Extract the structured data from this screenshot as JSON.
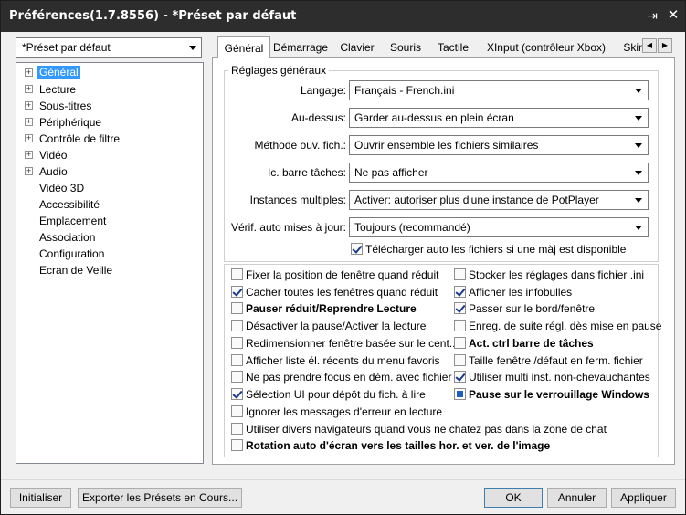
{
  "window": {
    "title": "Préférences(1.7.8556) - *Préset par défaut",
    "pin_glyph": "⇥",
    "close_glyph": "✕"
  },
  "preset_select": {
    "value": "*Préset par défaut"
  },
  "tree": {
    "items": [
      {
        "label": "Général",
        "expandable": true,
        "selected": true
      },
      {
        "label": "Lecture",
        "expandable": true
      },
      {
        "label": "Sous-titres",
        "expandable": true
      },
      {
        "label": "Périphérique",
        "expandable": true
      },
      {
        "label": "Contrôle de filtre",
        "expandable": true
      },
      {
        "label": "Vidéo",
        "expandable": true
      },
      {
        "label": "Audio",
        "expandable": true
      },
      {
        "label": "Vidéo 3D",
        "expandable": false
      },
      {
        "label": "Accessibilité",
        "expandable": false
      },
      {
        "label": "Emplacement",
        "expandable": false
      },
      {
        "label": "Association",
        "expandable": false
      },
      {
        "label": "Configuration",
        "expandable": false
      },
      {
        "label": "Ecran de Veille",
        "expandable": false
      }
    ],
    "expand_glyph": "+"
  },
  "tabs": [
    {
      "label": "Général",
      "active": true
    },
    {
      "label": "Démarrage"
    },
    {
      "label": "Clavier"
    },
    {
      "label": "Souris"
    },
    {
      "label": "Tactile"
    },
    {
      "label": "XInput (contrôleur Xbox)"
    },
    {
      "label": "Skin"
    }
  ],
  "tab_scroll": {
    "left": "◀",
    "right": "▶"
  },
  "general_group": {
    "title": "Réglages généraux",
    "rows": [
      {
        "label": "Langage:",
        "value": "Français - French.ini"
      },
      {
        "label": "Au-dessus:",
        "value": "Garder au-dessus en plein écran"
      },
      {
        "label": "Méthode ouv. fich.:",
        "value": "Ouvrir ensemble les fichiers similaires"
      },
      {
        "label": "Ic. barre tâches:",
        "value": "Ne pas afficher"
      },
      {
        "label": "Instances multiples:",
        "value": "Activer: autoriser plus d'une instance de PotPlayer"
      },
      {
        "label": "Vérif. auto mises à jour:",
        "value": "Toujours (recommandé)"
      }
    ],
    "auto_download": {
      "label": "Télécharger auto les fichiers si une màj est disponible",
      "checked": true
    }
  },
  "options": {
    "left": [
      {
        "label": "Fixer la position de fenêtre quand réduit",
        "checked": false
      },
      {
        "label": "Cacher toutes les fenêtres quand réduit",
        "checked": true
      },
      {
        "label": "Pauser réduit/Reprendre Lecture",
        "checked": false,
        "bold": true
      },
      {
        "label": "Désactiver la pause/Activer la lecture",
        "checked": false
      },
      {
        "label": "Redimensionner fenêtre basée sur le cent...",
        "checked": false
      },
      {
        "label": "Afficher liste él. récents du menu favoris",
        "checked": false
      },
      {
        "label": "Ne pas prendre focus en dém. avec fichier",
        "checked": false
      },
      {
        "label": "Sélection UI pour dépôt du fich. à lire",
        "checked": true
      }
    ],
    "right": [
      {
        "label": "Stocker les réglages dans fichier .ini",
        "checked": false
      },
      {
        "label": "Afficher les infobulles",
        "checked": true
      },
      {
        "label": "Passer sur le bord/fenêtre",
        "checked": true
      },
      {
        "label": "Enreg. de suite régl. dès mise en pause",
        "checked": false
      },
      {
        "label": "Act. ctrl barre de tâches",
        "checked": false,
        "bold": true
      },
      {
        "label": "Taille fenêtre /défaut en ferm. fichier",
        "checked": false
      },
      {
        "label": "Utiliser multi inst. non-chevauchantes",
        "checked": true
      },
      {
        "label": "Pause sur le verrouillage Windows",
        "checked": "indeterminate",
        "bold": true
      }
    ],
    "full": [
      {
        "label": "Ignorer les messages d'erreur en lecture",
        "checked": false
      },
      {
        "label": "Utiliser divers navigateurs quand vous ne chatez pas dans la zone de chat",
        "checked": false
      },
      {
        "label": "Rotation auto d'écran vers les tailles hor. et ver. de l'image",
        "checked": false,
        "bold": true
      }
    ]
  },
  "buttons": {
    "init": "Initialiser",
    "export": "Exporter les Présets en Cours...",
    "ok": "OK",
    "cancel": "Annuler",
    "apply": "Appliquer"
  }
}
